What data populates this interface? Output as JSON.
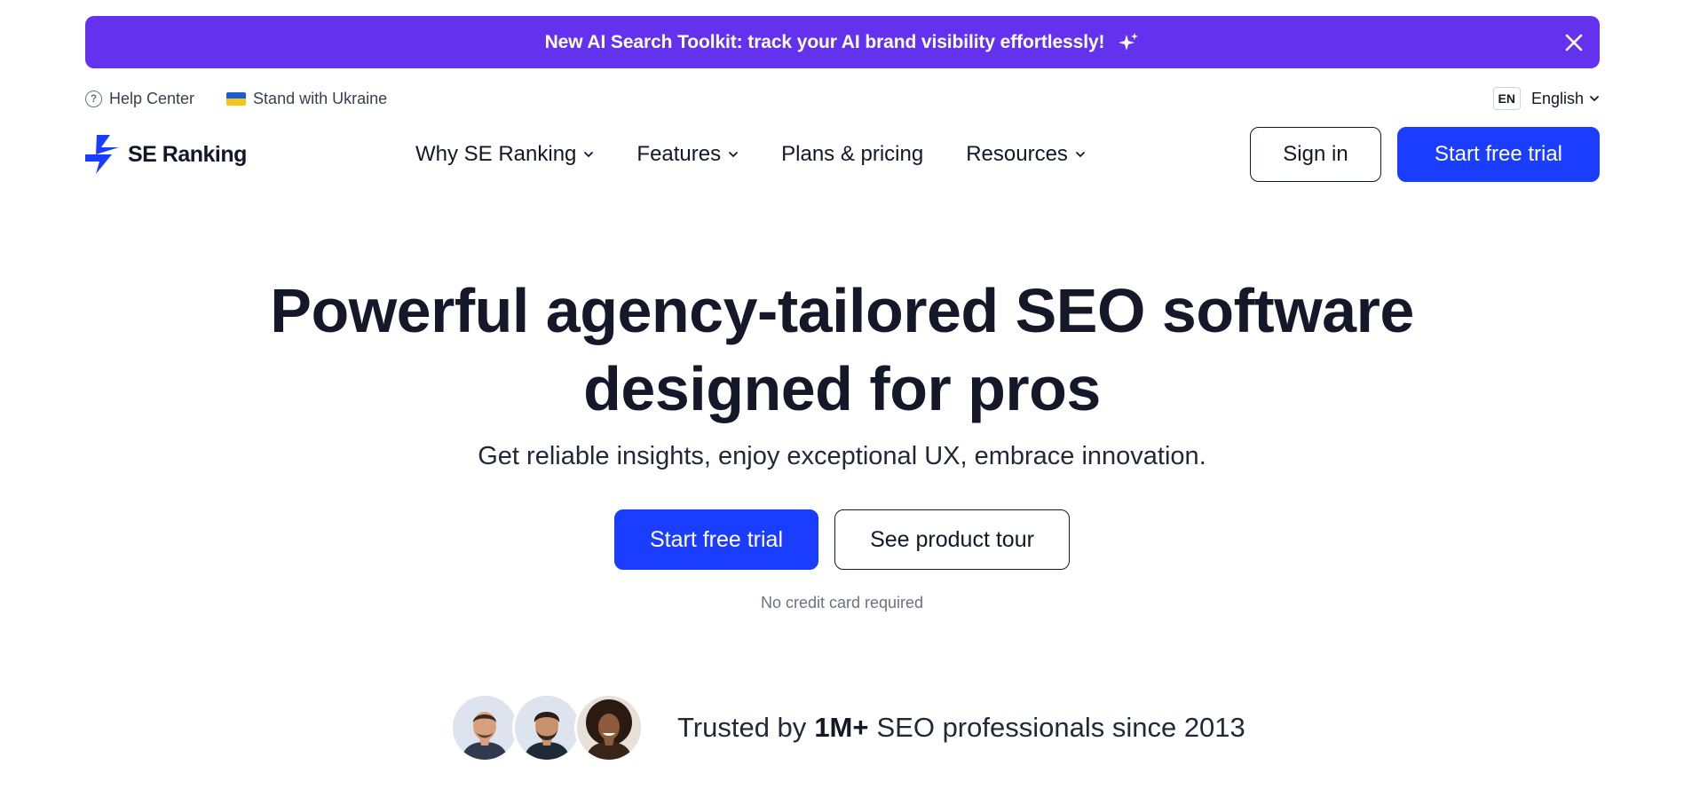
{
  "banner": {
    "text": "New AI Search Toolkit: track your AI brand visibility effortlessly!",
    "sparkle_icon": "sparkle-icon",
    "close_icon": "close-icon",
    "background_color": "#6432ef"
  },
  "utility": {
    "help_label": "Help Center",
    "ukraine_label": "Stand with Ukraine",
    "lang_code": "EN",
    "lang_name": "English"
  },
  "nav": {
    "logo_text": "SE Ranking",
    "items": [
      {
        "label": "Why SE Ranking",
        "has_dropdown": true
      },
      {
        "label": "Features",
        "has_dropdown": true
      },
      {
        "label": "Plans & pricing",
        "has_dropdown": false
      },
      {
        "label": "Resources",
        "has_dropdown": true
      }
    ],
    "sign_in_label": "Sign in",
    "trial_label": "Start free trial"
  },
  "hero": {
    "title_line1": "Powerful agency-tailored SEO software",
    "title_line2": "designed for pros",
    "subtitle": "Get reliable insights, enjoy exceptional UX, embrace innovation.",
    "primary_cta": "Start free trial",
    "secondary_cta": "See product tour",
    "note": "No credit card required"
  },
  "trust": {
    "prefix": "Trusted by",
    "highlight": "1M+",
    "suffix": "SEO professionals since 2013"
  },
  "colors": {
    "accent_blue": "#1a3dff",
    "banner_purple": "#6432ef",
    "text_dark": "#141828"
  }
}
